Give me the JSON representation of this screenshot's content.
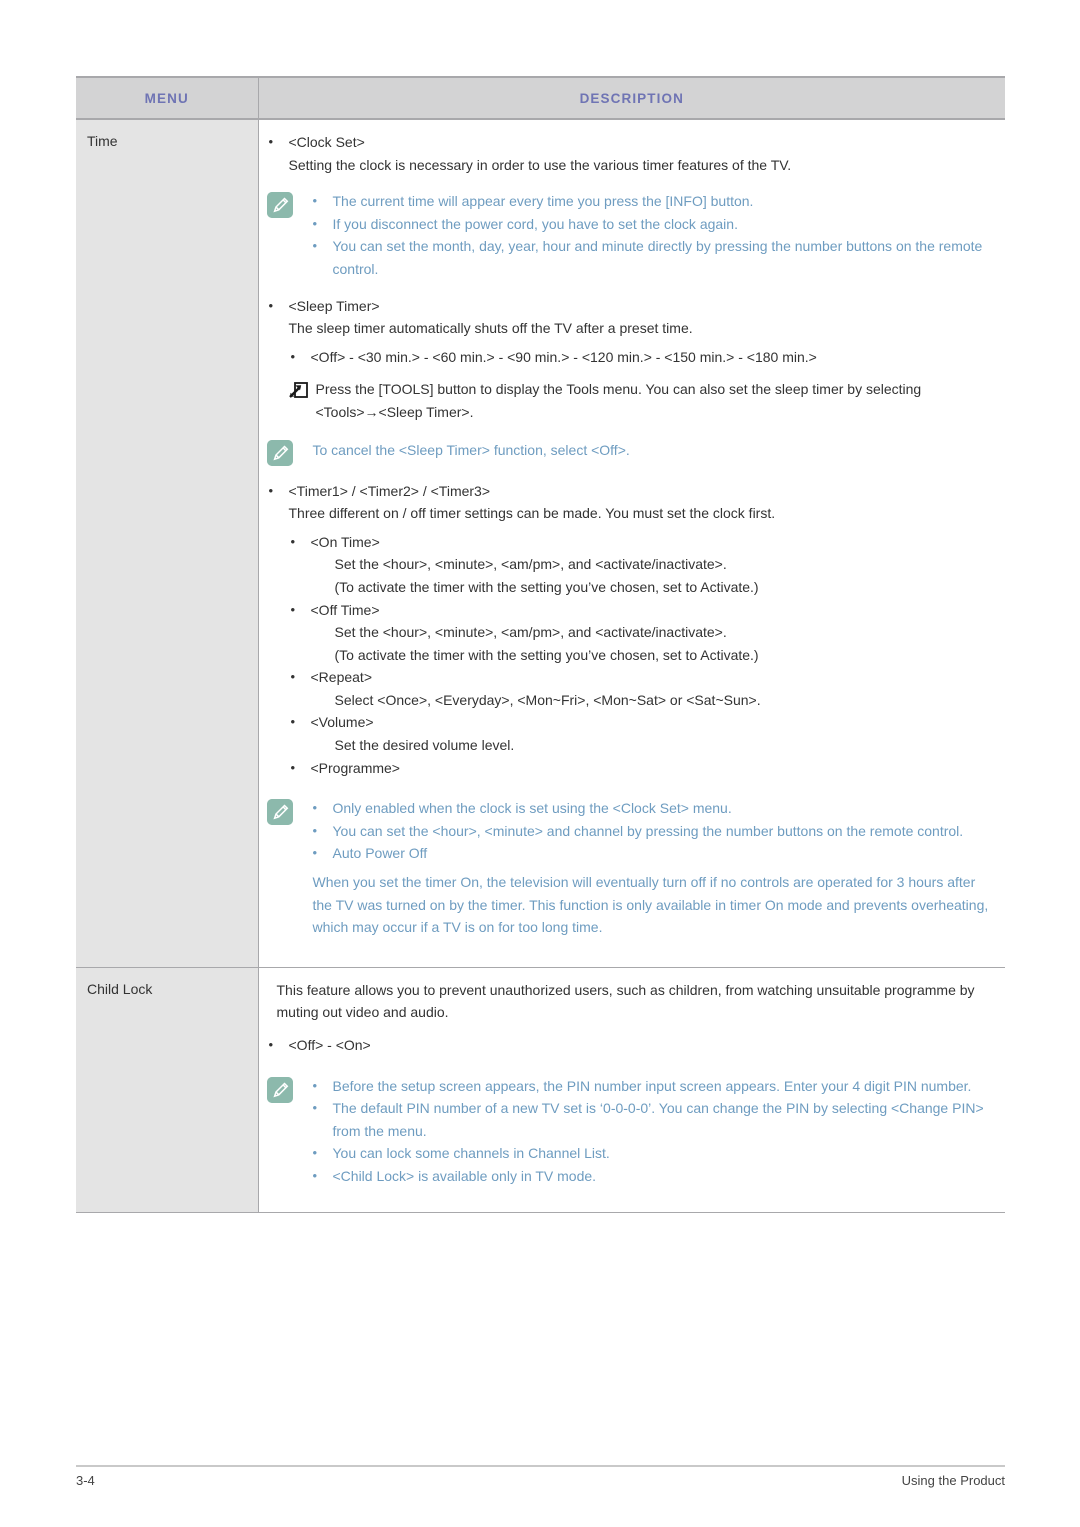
{
  "table": {
    "headers": {
      "menu": "MENU",
      "description": "DESCRIPTION"
    },
    "header_text_color": "#6f74b4",
    "header_bg_color": "#d3d3d4",
    "menu_cell_bg_color": "#e4e4e4",
    "note_text_color": "#6e9cc0",
    "note_icon_color": "#8cb9ac",
    "rows": [
      {
        "menu": "Time",
        "blocks": [
          {
            "kind": "bullet1",
            "text": "<Clock Set>"
          },
          {
            "kind": "body1",
            "text": "Setting the clock is necessary in order to use the various timer features of the TV."
          },
          {
            "kind": "note-list",
            "icon": "note-pencil-icon",
            "items": [
              "The current time will appear every time you press the [INFO] button.",
              "If you disconnect the power cord, you have to set the clock again.",
              "You can set the month, day, year, hour and minute directly by pressing the number buttons on the remote control."
            ]
          },
          {
            "kind": "bullet1",
            "text": "<Sleep Timer>"
          },
          {
            "kind": "body1",
            "text": "The sleep timer automatically shuts off the TV after a preset time."
          },
          {
            "kind": "bullet2",
            "text": "<Off> - <30 min.> - <60 min.> - <90 min.> - <120 min.> - <150 min.> - <180 min.>"
          },
          {
            "kind": "tools",
            "icon": "tools-shortcut-icon",
            "text": "Press the [TOOLS] button to display the Tools menu. You can also set the sleep timer by selecting <Tools>→<Sleep Timer>."
          },
          {
            "kind": "note-single",
            "icon": "note-pencil-icon",
            "text": "To cancel the <Sleep Timer> function, select <Off>."
          },
          {
            "kind": "bullet1",
            "text": "<Timer1> / <Timer2> / <Timer3>"
          },
          {
            "kind": "body1",
            "text": "Three different on / off timer settings can be made. You must set the clock first."
          },
          {
            "kind": "bullet2",
            "text": "<On Time>"
          },
          {
            "kind": "body2",
            "text": "Set the <hour>, <minute>, <am/pm>, and <activate/inactivate>."
          },
          {
            "kind": "body2",
            "text": "(To activate the timer with the setting you’ve chosen, set to Activate.)"
          },
          {
            "kind": "bullet2",
            "text": "<Off Time>"
          },
          {
            "kind": "body2",
            "text": "Set the <hour>, <minute>, <am/pm>, and <activate/inactivate>."
          },
          {
            "kind": "body2",
            "text": "(To activate the timer with the setting you’ve chosen, set to Activate.)"
          },
          {
            "kind": "bullet2",
            "text": "<Repeat>"
          },
          {
            "kind": "body2",
            "text": "Select <Once>, <Everyday>, <Mon~Fri>, <Mon~Sat> or <Sat~Sun>."
          },
          {
            "kind": "bullet2",
            "text": "<Volume>"
          },
          {
            "kind": "body2",
            "text": "Set the desired volume level."
          },
          {
            "kind": "bullet2",
            "text": "<Programme>"
          },
          {
            "kind": "note-list",
            "icon": "note-pencil-icon",
            "items": [
              "Only enabled when the clock is set using the <Clock Set> menu.",
              "You can set the <hour>, <minute> and channel by pressing the number buttons on the remote control.",
              "Auto Power Off"
            ],
            "paragraph": "When you set the timer On, the television will eventually turn off if no controls are operated for 3 hours after the TV was turned on by the timer. This function is only available in timer On mode and prevents overheating, which may occur if a TV is on for too long time."
          }
        ]
      },
      {
        "menu": "Child Lock",
        "blocks": [
          {
            "kind": "body0",
            "text": "This feature allows you to prevent unauthorized users, such as children, from watching unsuitable programme by muting out video and audio."
          },
          {
            "kind": "bullet1",
            "text": "<Off> - <On>"
          },
          {
            "kind": "note-list",
            "icon": "note-pencil-icon",
            "items": [
              "Before the setup screen appears, the PIN number input screen appears. Enter your 4 digit PIN number.",
              "The default PIN number of a new TV set is ‘0-0-0-0’. You can change the PIN by selecting <Change PIN> from the menu.",
              "You can lock some channels in Channel List.",
              "<Child Lock> is available only in TV mode."
            ]
          }
        ]
      }
    ]
  },
  "footer": {
    "page_number": "3-4",
    "section": "Using the Product"
  }
}
